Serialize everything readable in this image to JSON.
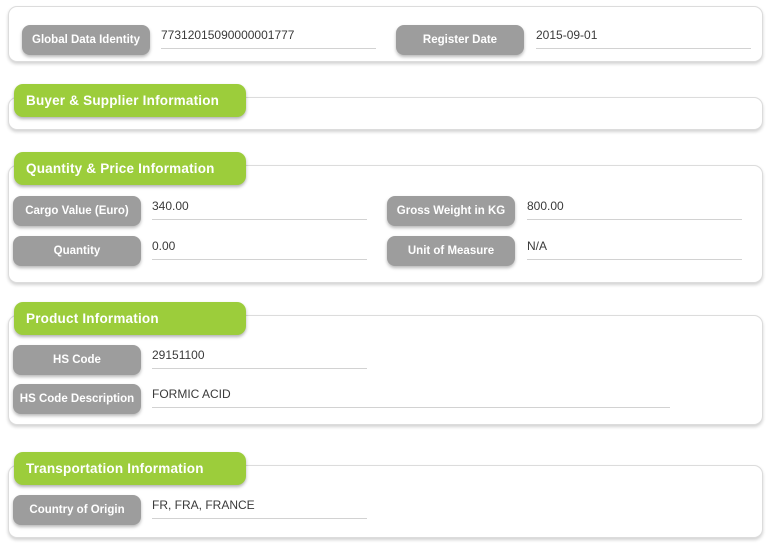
{
  "sections": [
    {
      "id": "identity",
      "title": null,
      "fields": [
        {
          "label": "Global Data Identity",
          "value": "77312015090000001777"
        },
        {
          "label": "Register Date",
          "value": "2015-09-01"
        }
      ]
    },
    {
      "id": "buyer-supplier",
      "title": "Buyer & Supplier Information",
      "fields": []
    },
    {
      "id": "quantity-price",
      "title": "Quantity & Price Information",
      "fields": [
        {
          "label": "Cargo Value (Euro)",
          "value": "340.00"
        },
        {
          "label": "Gross Weight in KG",
          "value": "800.00"
        },
        {
          "label": "Quantity",
          "value": "0.00"
        },
        {
          "label": "Unit of Measure",
          "value": "N/A"
        }
      ]
    },
    {
      "id": "product",
      "title": "Product Information",
      "fields": [
        {
          "label": "HS Code",
          "value": "29151100"
        },
        {
          "label": "HS Code Description",
          "value": "FORMIC ACID"
        }
      ]
    },
    {
      "id": "transportation",
      "title": "Transportation Information",
      "fields": [
        {
          "label": "Country of Origin",
          "value": "FR, FRA, FRANCE"
        }
      ]
    }
  ],
  "colors": {
    "section_header_green": "#9ccd3b",
    "field_label_gray": "#9d9d9d",
    "panel_border": "#dcdcdc",
    "underline": "#d2d2d2",
    "value_text": "#3a3a3a",
    "page_background": "#ffffff"
  }
}
